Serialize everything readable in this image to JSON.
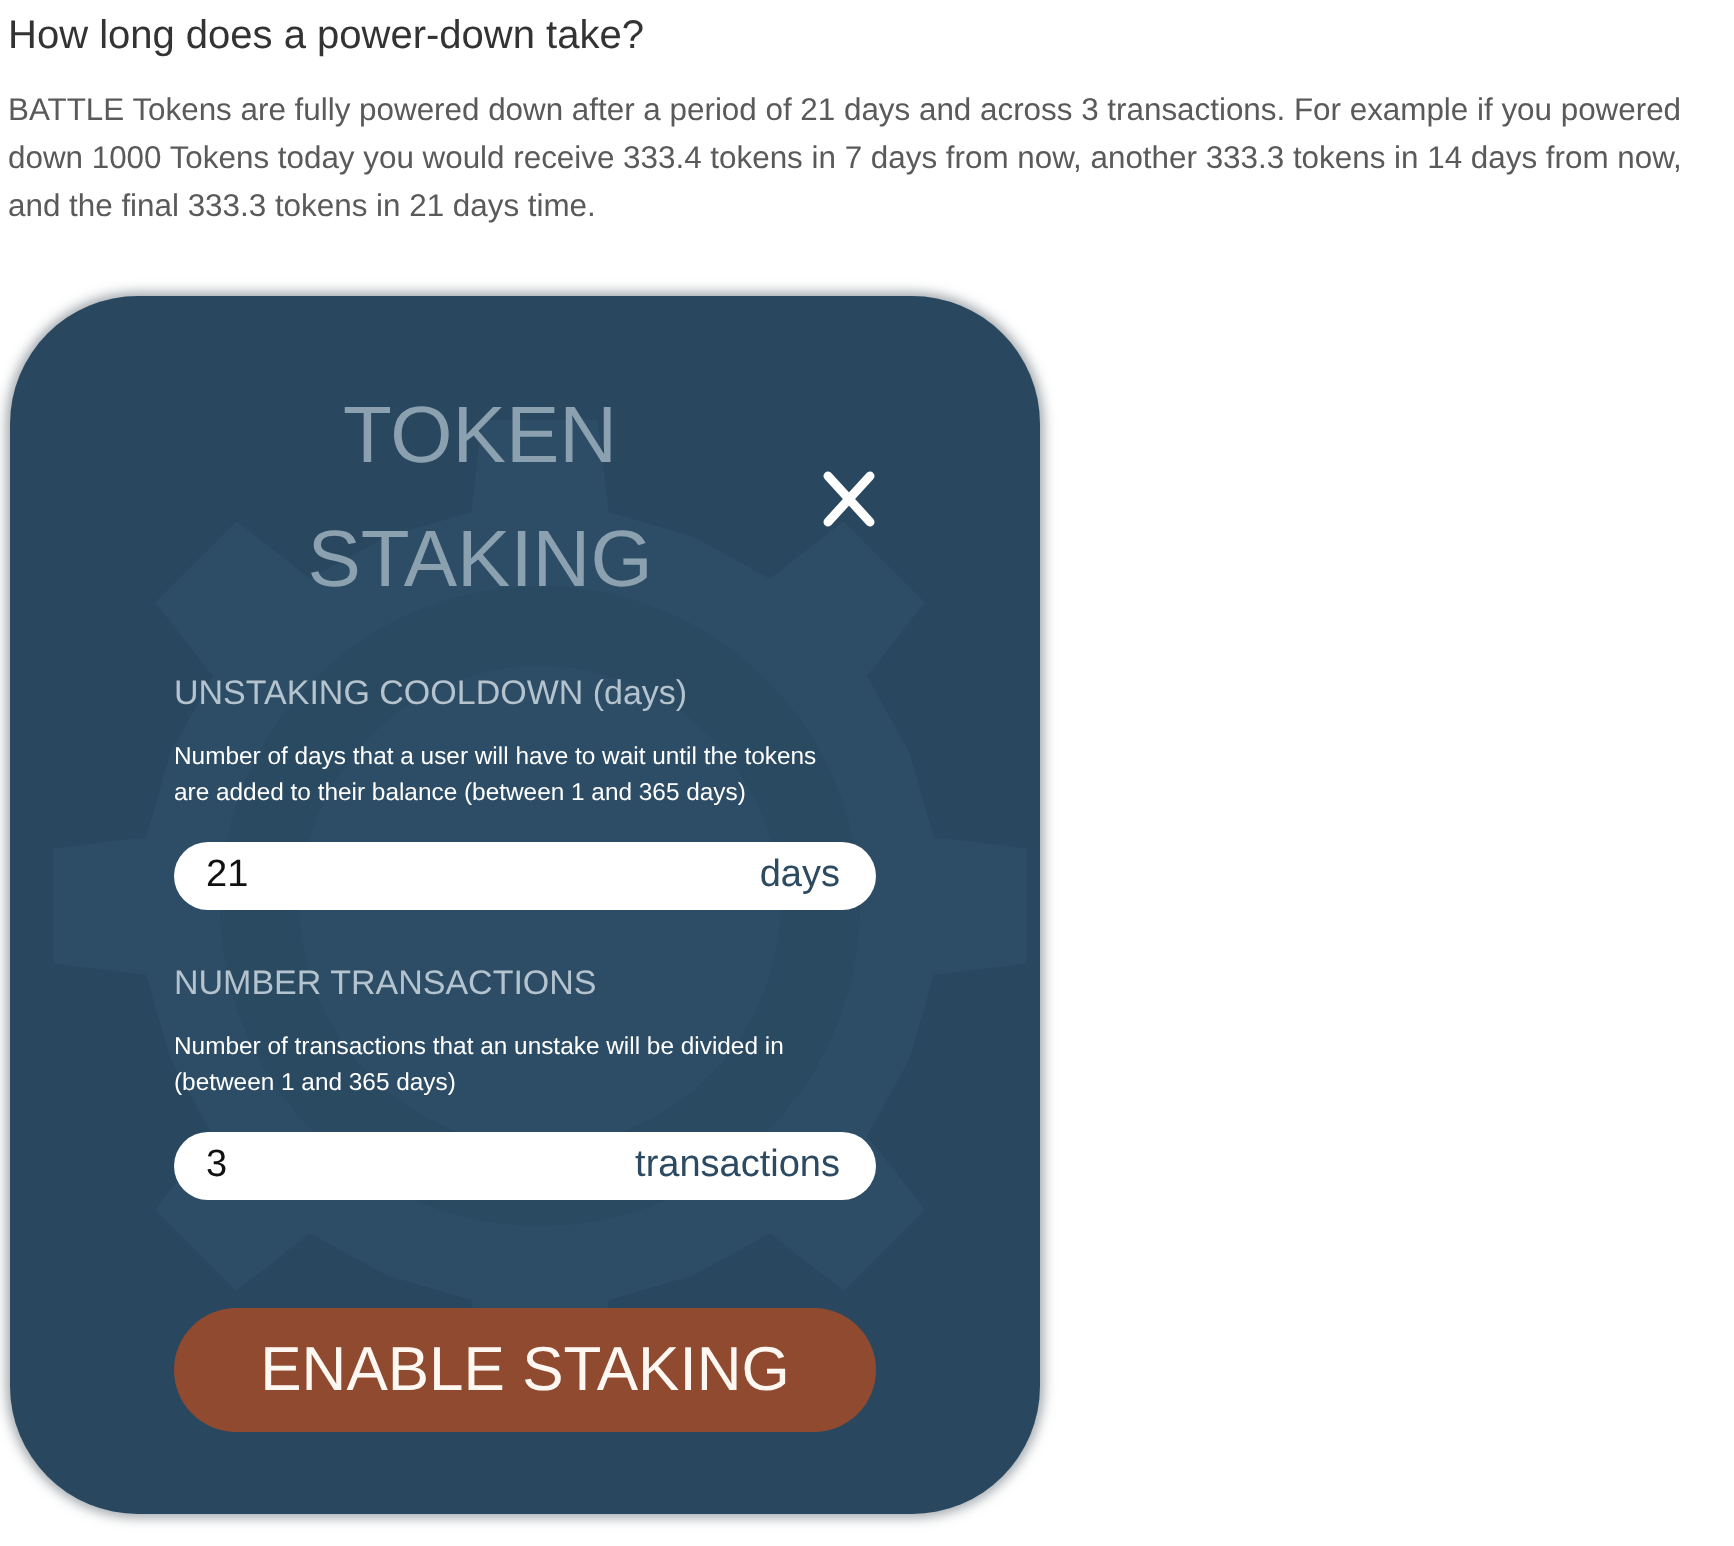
{
  "heading": "How long does a power-down take?",
  "paragraph": "BATTLE Tokens are fully powered down after a period of 21 days and across 3 transactions. For example if you powered down 1000 Tokens today you would receive 333.4 tokens in 7 days from now, another 333.3 tokens in 14 days from now, and the final 333.3 tokens in 21 days time.",
  "dialog": {
    "title": "TOKEN STAKING",
    "fields": [
      {
        "label": "UNSTAKING COOLDOWN (days)",
        "help": "Number of days that a user will have to wait until the tokens are added to their balance (between 1 and 365 days)",
        "value": "21",
        "unit": "days"
      },
      {
        "label": "NUMBER TRANSACTIONS",
        "help": "Number of transactions that an unstake will be divided in (between 1 and 365 days)",
        "value": "3",
        "unit": "transactions"
      }
    ],
    "button": "ENABLE STAKING"
  }
}
